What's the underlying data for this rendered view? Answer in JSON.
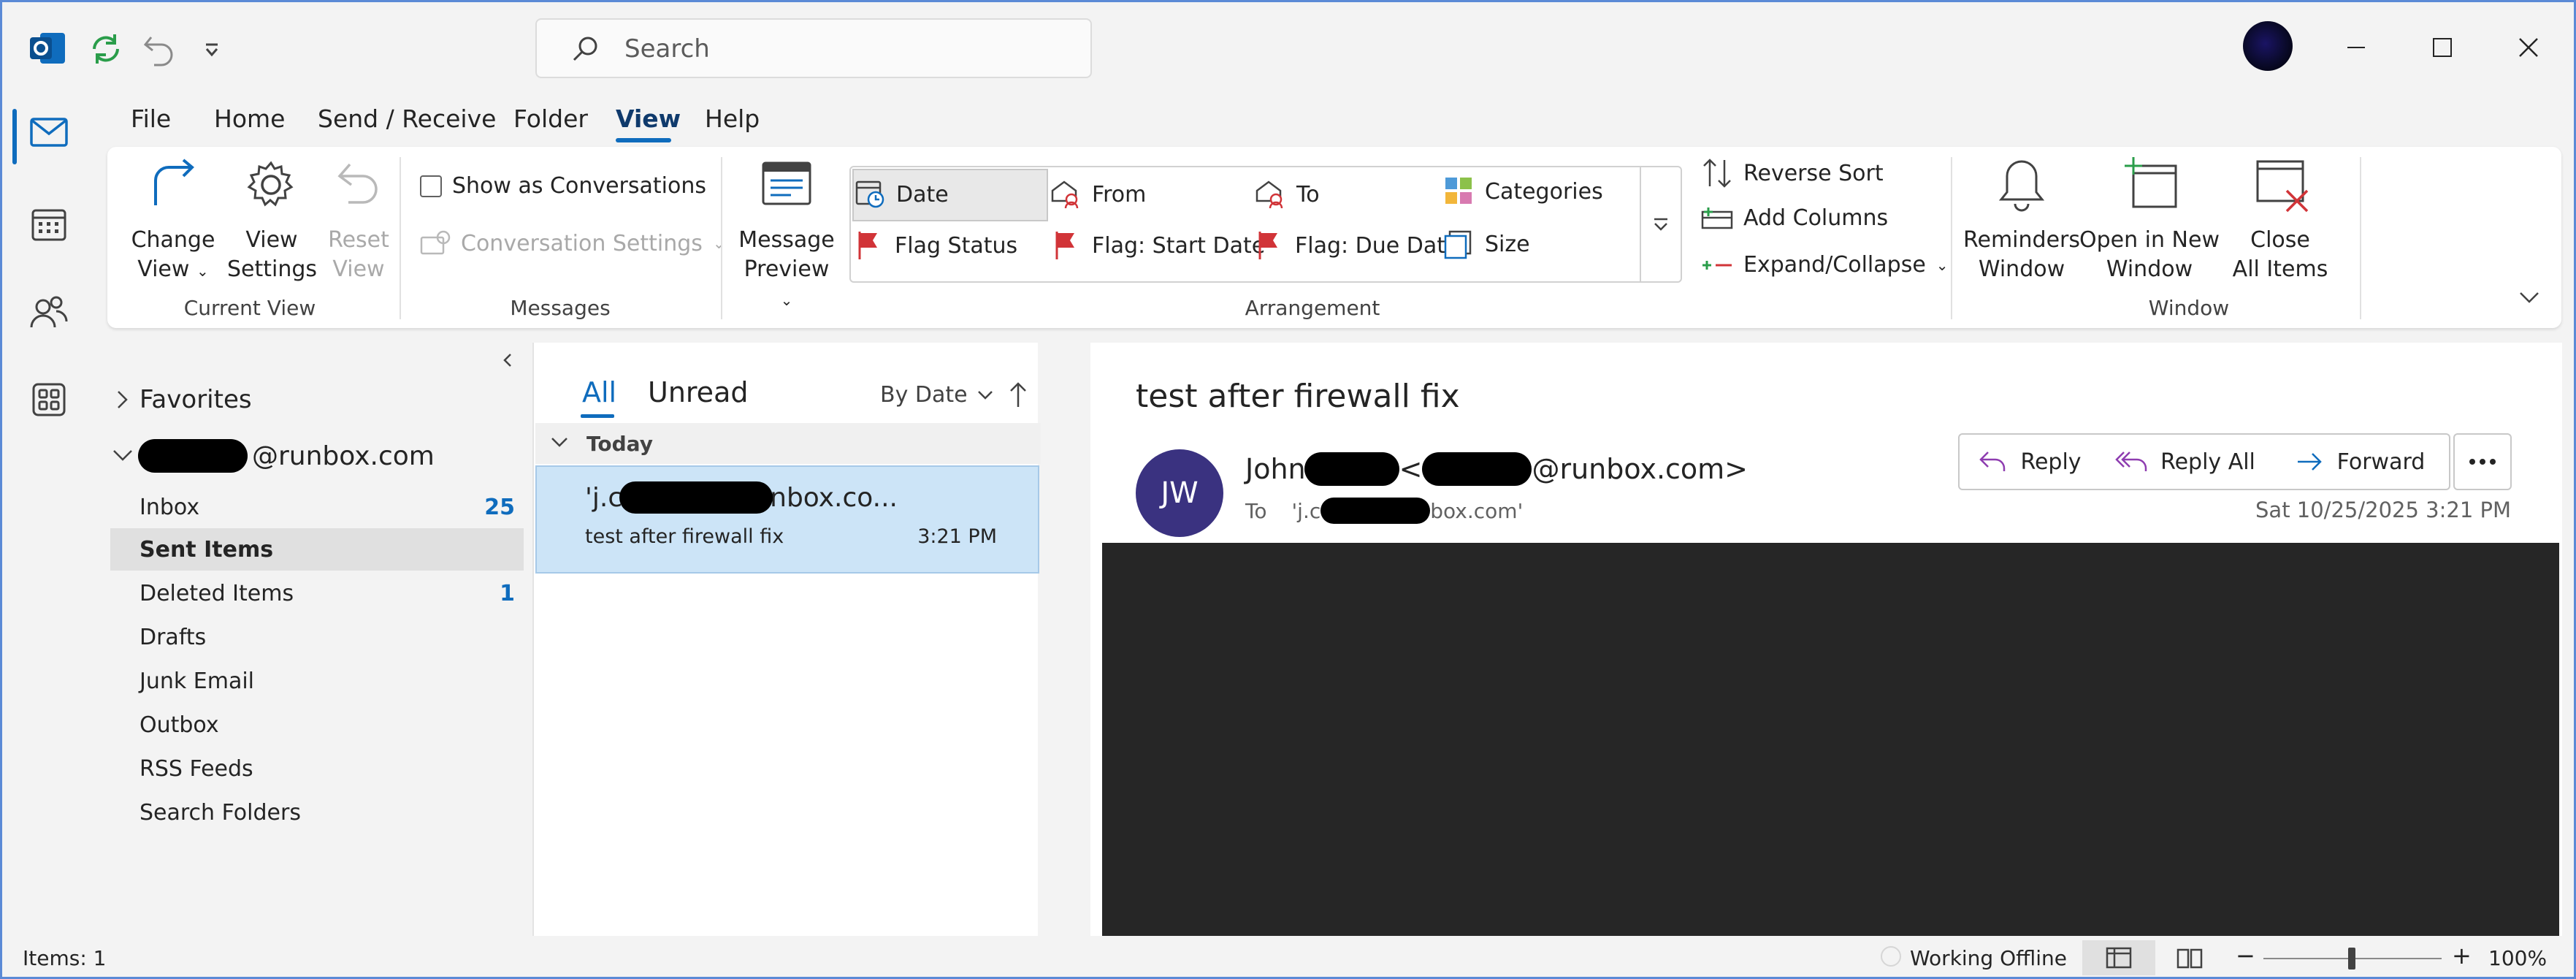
{
  "titlebar": {
    "search_placeholder": "Search",
    "icons": [
      "outlook-logo-icon",
      "sync-icon",
      "undo-icon",
      "customize-toolbar-icon"
    ]
  },
  "menu": {
    "tabs": [
      "File",
      "Home",
      "Send / Receive",
      "Folder",
      "View",
      "Help"
    ],
    "active": "View"
  },
  "ribbon": {
    "current_view": {
      "change_view_line1": "Change",
      "change_view_line2": "View",
      "view_settings_line1": "View",
      "view_settings_line2": "Settings",
      "reset_view_line1": "Reset",
      "reset_view_line2": "View",
      "group": "Current View"
    },
    "messages": {
      "show_as_conversations": "Show as Conversations",
      "conversation_settings": "Conversation Settings",
      "group": "Messages"
    },
    "arrangement": {
      "message_preview_line1": "Message",
      "message_preview_line2": "Preview",
      "items": {
        "date": "Date",
        "from": "From",
        "to": "To",
        "categories": "Categories",
        "flag_status": "Flag Status",
        "flag_start_date": "Flag: Start Date",
        "flag_due_date": "Flag: Due Date",
        "size": "Size"
      },
      "selected": "Date",
      "reverse_sort": "Reverse Sort",
      "add_columns": "Add Columns",
      "expand_collapse": "Expand/Collapse",
      "group": "Arrangement"
    },
    "window": {
      "reminders_line1": "Reminders",
      "reminders_line2": "Window",
      "open_new_line1": "Open in New",
      "open_new_line2": "Window",
      "close_all_line1": "Close",
      "close_all_line2": "All Items",
      "group": "Window"
    }
  },
  "folders": {
    "favorites": "Favorites",
    "account": "@runbox.com",
    "items": [
      {
        "label": "Inbox",
        "count": "25"
      },
      {
        "label": "Sent Items",
        "count": ""
      },
      {
        "label": "Deleted Items",
        "count": "1"
      },
      {
        "label": "Drafts",
        "count": ""
      },
      {
        "label": "Junk Email",
        "count": ""
      },
      {
        "label": "Outbox",
        "count": ""
      },
      {
        "label": "RSS Feeds",
        "count": ""
      },
      {
        "label": "Search Folders",
        "count": ""
      }
    ],
    "selected": "Sent Items"
  },
  "message_list": {
    "tab_all": "All",
    "tab_unread": "Unread",
    "sort_by": "By Date",
    "group_header": "Today",
    "message": {
      "recipient_prefix": "'j.c",
      "recipient_suffix": "nbox.co...",
      "subject": "test after firewall fix",
      "time": "3:21 PM"
    }
  },
  "reading_pane": {
    "subject": "test after firewall fix",
    "avatar_initials": "JW",
    "from_prefix": "John",
    "from_suffix": "@runbox.com>",
    "from_bracket": "<",
    "to_label": "To",
    "to_prefix": "'j.c",
    "to_suffix": "box.com'",
    "date": "Sat 10/25/2025 3:21 PM",
    "actions": {
      "reply": "Reply",
      "reply_all": "Reply All",
      "forward": "Forward"
    }
  },
  "statusbar": {
    "items": "Items: 1",
    "status": "Working Offline",
    "zoom": "100%"
  },
  "colors": {
    "accent": "#0f6cbd",
    "avatar_bg": "#3a3280",
    "selected_message": "#cce4f7",
    "flag_red": "#d13438"
  }
}
